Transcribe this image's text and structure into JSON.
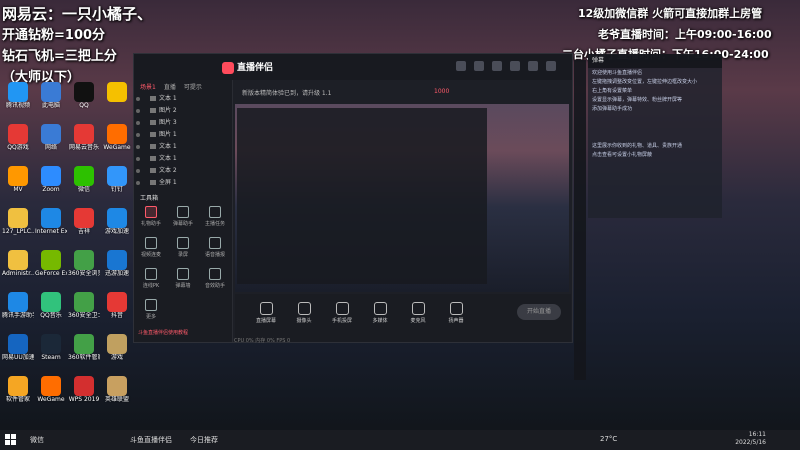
{
  "overlay": {
    "top_left_1": "网易云：一只小橘子、",
    "top_left_2": "开通钻粉=100分",
    "top_left_3": "钻石飞机=三把上分",
    "top_left_4": "（大师以下）",
    "top_right_1": "12级加微信群  火箭可直接加群上房管",
    "top_right_2": "老爷直播时间：上午09:00-16:00",
    "top_right_3": "二台小橘子直播时间：下午16:00-24:00",
    "small_label": "钻石飞机"
  },
  "desktop_icons": [
    {
      "label": "腾讯视频",
      "color": "#2196f3"
    },
    {
      "label": "此电脑",
      "color": "#3a7bd5"
    },
    {
      "label": "QQ",
      "color": "#111"
    },
    {
      "label": "",
      "color": "#f5c000"
    },
    {
      "label": "QQ游戏",
      "color": "#e53935"
    },
    {
      "label": "网络",
      "color": "#3a7bd5"
    },
    {
      "label": "网易云音乐",
      "color": "#e53935"
    },
    {
      "label": "WeGame",
      "color": "#ff6d00"
    },
    {
      "label": "MV",
      "color": "#ff9800"
    },
    {
      "label": "Zoom",
      "color": "#2d8cff"
    },
    {
      "label": "微信",
      "color": "#2dc100"
    },
    {
      "label": "钉钉",
      "color": "#3296fa"
    },
    {
      "label": "127_LPLC...",
      "color": "#f0c040"
    },
    {
      "label": "Internet Explorer",
      "color": "#1e88e5"
    },
    {
      "label": "吉祥",
      "color": "#e53935"
    },
    {
      "label": "游戏加速",
      "color": "#1e88e5"
    },
    {
      "label": "Administr...",
      "color": "#f0c040"
    },
    {
      "label": "GeForce Experience",
      "color": "#76b900"
    },
    {
      "label": "360安全浏览器",
      "color": "#43a047"
    },
    {
      "label": "迅游加速",
      "color": "#1976d2"
    },
    {
      "label": "腾讯手游助手",
      "color": "#1e88e5"
    },
    {
      "label": "QQ音乐",
      "color": "#31c27c"
    },
    {
      "label": "360安全卫士",
      "color": "#43a047"
    },
    {
      "label": "抖音",
      "color": "#e53935"
    },
    {
      "label": "网易UU加速",
      "color": "#1565c0"
    },
    {
      "label": "Steam",
      "color": "#1b2838"
    },
    {
      "label": "360软件管家",
      "color": "#43a047"
    },
    {
      "label": "游戏",
      "color": "#c0a060"
    },
    {
      "label": "软件管家",
      "color": "#f5a623"
    },
    {
      "label": "WeGame",
      "color": "#ff6d00"
    },
    {
      "label": "WPS 2019",
      "color": "#d32f2f"
    },
    {
      "label": "英雄联盟",
      "color": "#c8a060"
    }
  ],
  "app": {
    "title": "直播伴侣",
    "tabs": [
      "场景1",
      "直播",
      "可提示"
    ],
    "sources": [
      "文本 1",
      "图片 2",
      "图片 3",
      "图片 1",
      "文本 1",
      "文本 1",
      "文本 2",
      "全屏 1"
    ],
    "tools_title": "工具箱",
    "tools": [
      "礼物助手",
      "弹幕助手",
      "主播任务",
      "视频连麦",
      "录屏",
      "语音播报",
      "连线PK",
      "弹幕墙",
      "音效助手",
      "更多"
    ],
    "notice": "斗鱼直播伴侣使用教程",
    "header_text": "新版本精简体验已到，请升级 1.1",
    "bottom_buttons": [
      "直播屏幕",
      "摄像头",
      "手机投屏",
      "多媒体",
      "麦克风",
      "扬声器"
    ],
    "start_label": "开始直播",
    "status": "CPU 0%   内存 0%   FPS 0",
    "pill": "1000"
  },
  "chat": {
    "header": "弹幕",
    "lines": [
      "欢迎使用斗鱼直播伴侣",
      "左键拖拽调整改变位置，左键拉伸边框改变大小",
      "右上角有设置菜单",
      "设置显示弹幕，弹幕特效、粉丝牌开屏等",
      "添加弹幕助手成功",
      "这里展示你收到的礼物、道具、贵族开通",
      "点击查看可设置小礼物屏蔽"
    ]
  },
  "taskbar": {
    "items": [
      "微信",
      "斗鱼直播伴侣",
      "今日推荐"
    ],
    "weather": "27°C",
    "time": "16:11",
    "date": "2022/5/16"
  }
}
